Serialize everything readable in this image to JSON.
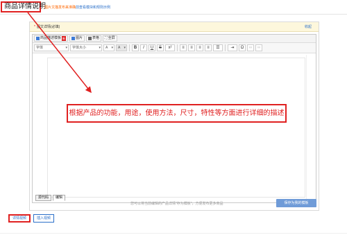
{
  "header": {
    "title": "商品详情说明",
    "tip_orange": "图片文描发布来准确",
    "tip_blue": "前查看模块和规则示例"
  },
  "panel": {
    "required_label": "图文详情(必填)",
    "collapse_label": "收起",
    "toolbar1": {
      "module_btn": "商品描述模板",
      "new_badge": "新",
      "image_btn": "图片",
      "table_btn": "表格",
      "fullscreen_btn": "全屏"
    },
    "toolbar2": {
      "font_select": "字体",
      "size_select": "字体大小",
      "color_btn": "A",
      "bgcolor_btn": "A",
      "bold": "B",
      "italic": "I",
      "underline": "U",
      "strike": "S",
      "superscript": "x²",
      "omega": "Ω"
    },
    "mode_tabs": [
      "源代码",
      "编辑"
    ],
    "footer_hint": "您可以将当前编辑的产品详情\"存为模板\"，方便发布更多商品",
    "save_template": "保存为我的模板"
  },
  "buttons": {
    "detail_video": "详情视频",
    "insert_video": "插入视频"
  },
  "annotation": {
    "callout_text": "根据产品的功能，用途，使用方法，尺寸，特性等方面进行详细的描述",
    "color": "#e02020"
  }
}
